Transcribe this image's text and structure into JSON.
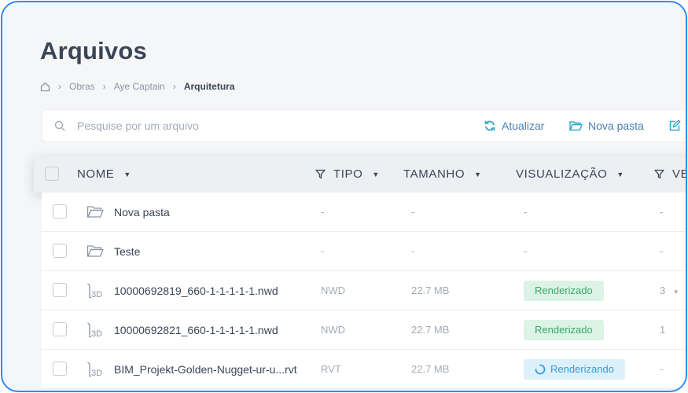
{
  "page": {
    "title": "Arquivos"
  },
  "breadcrumb": {
    "home_icon": "home-icon",
    "items": [
      "Obras",
      "Aye Captain",
      "Arquitetura"
    ]
  },
  "toolbar": {
    "search_placeholder": "Pesquise por um arquivo",
    "refresh_label": "Atualizar",
    "new_folder_label": "Nova pasta",
    "edit_icon": "edit-icon"
  },
  "table": {
    "columns": {
      "name": "NOME",
      "type": "TIPO",
      "size": "TAMANHO",
      "view": "VISUALIZAÇÃO",
      "version": "VE"
    },
    "rows": [
      {
        "icon": "folder-icon",
        "name": "Nova pasta",
        "type": "-",
        "size": "-",
        "status": "-",
        "status_kind": "none",
        "version": "-"
      },
      {
        "icon": "folder-icon",
        "name": "Teste",
        "type": "-",
        "size": "-",
        "status": "-",
        "status_kind": "none",
        "version": "-"
      },
      {
        "icon": "file-3d-icon",
        "name": "10000692819_660-1-1-1-1-1.nwd",
        "type": "NWD",
        "size": "22.7 MB",
        "status": "Renderizado",
        "status_kind": "done",
        "version": "3"
      },
      {
        "icon": "file-3d-icon",
        "name": "10000692821_660-1-1-1-1-1.nwd",
        "type": "NWD",
        "size": "22.7 MB",
        "status": "Renderizado",
        "status_kind": "done",
        "version": "1"
      },
      {
        "icon": "file-3d-icon",
        "name": "BIM_Projekt-Golden-Nugget-ur-u...rvt",
        "type": "RVT",
        "size": "22.7 MB",
        "status": "Renderizando",
        "status_kind": "progress",
        "version": "-"
      }
    ]
  },
  "colors": {
    "accent": "#2f8cf0",
    "done_bg": "#dcf3e6",
    "done_text": "#3aa86a",
    "progress_bg": "#dcf1fb",
    "progress_text": "#3a9ad6"
  }
}
